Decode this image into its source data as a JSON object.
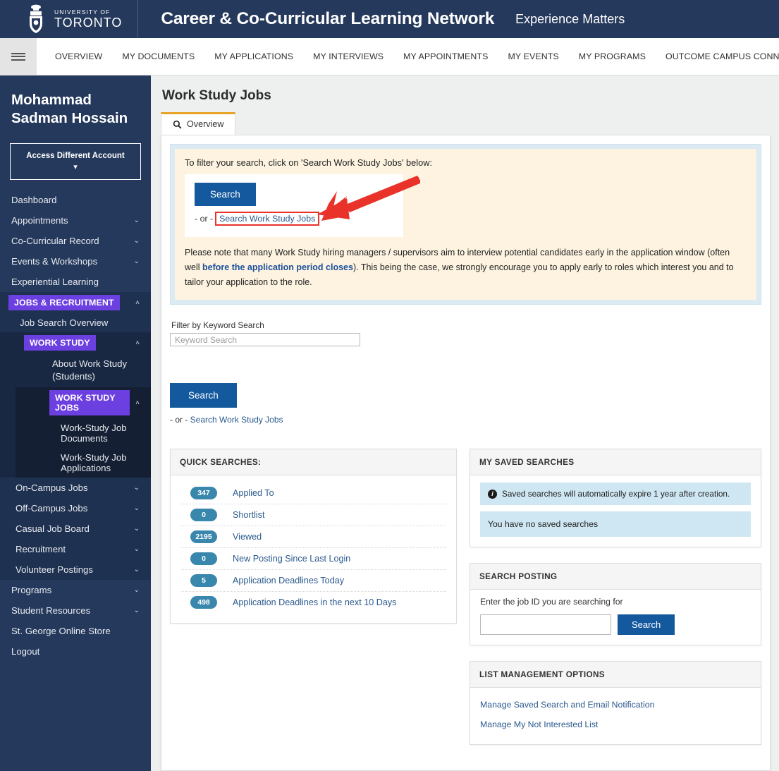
{
  "brand": {
    "logo_line1": "UNIVERSITY OF",
    "logo_line2": "TORONTO",
    "title": "Career & Co-Curricular Learning Network",
    "subtitle": "Experience Matters",
    "navy": "#25395c"
  },
  "topnav": {
    "menu_icon": "hamburger-icon",
    "items": [
      "OVERVIEW",
      "MY DOCUMENTS",
      "MY APPLICATIONS",
      "MY INTERVIEWS",
      "MY APPOINTMENTS",
      "MY EVENTS",
      "MY PROGRAMS",
      "OUTCOME CAMPUS CONNECT"
    ]
  },
  "sidebar": {
    "user_line1": "Mohammad",
    "user_line2": "Sadman Hossain",
    "account_switch": "Access Different Account",
    "accent_purple": "#6b3fe0",
    "items": [
      {
        "label": "Dashboard",
        "chevron": ""
      },
      {
        "label": "Appointments",
        "chevron": "⌄"
      },
      {
        "label": "Co-Curricular Record",
        "chevron": "⌄"
      },
      {
        "label": "Events & Workshops",
        "chevron": "⌄"
      },
      {
        "label": "Experiential Learning",
        "chevron": ""
      }
    ],
    "jobs_section": {
      "label": "JOBS & RECRUITMENT",
      "chevron": "˄",
      "overview": "Job Search Overview",
      "work_study": {
        "label": "WORK STUDY",
        "chevron": "˄",
        "about": "About Work Study (Students)",
        "jobs": {
          "label": "WORK STUDY JOBS",
          "chevron": "˄",
          "children": [
            "Work-Study Job Documents",
            "Work-Study Job Applications"
          ]
        }
      },
      "siblings": [
        {
          "label": "On-Campus Jobs",
          "chevron": "⌄"
        },
        {
          "label": "Off-Campus Jobs",
          "chevron": "⌄"
        },
        {
          "label": "Casual Job Board",
          "chevron": "⌄"
        },
        {
          "label": "Recruitment",
          "chevron": "⌄"
        },
        {
          "label": "Volunteer Postings",
          "chevron": "⌄"
        }
      ]
    },
    "footer_items": [
      {
        "label": "Programs",
        "chevron": "⌄"
      },
      {
        "label": "Student Resources",
        "chevron": "⌄"
      },
      {
        "label": "St. George Online Store",
        "chevron": ""
      },
      {
        "label": "Logout",
        "chevron": ""
      }
    ]
  },
  "page": {
    "title": "Work Study Jobs",
    "tab_label": "Overview",
    "tab_icon": "search-icon"
  },
  "alert": {
    "lead": "To filter your search, click on 'Search Work Study Jobs' below:",
    "search_button": "Search",
    "or_text": "- or -",
    "highlight_link": "Search Work Study Jobs",
    "body_part1": "Please note that many Work Study hiring managers / supervisors aim to interview potential candidates early in the application window (often well ",
    "body_bold": "before the application period closes",
    "body_part2": "). This being the case, we strongly encourage you to apply early to roles which interest you and to tailor your application to the role.",
    "annotation": "red-arrow-pointing-to-search-work-study-jobs-link",
    "annotation_color": "#e8322a"
  },
  "filter": {
    "label": "Filter by Keyword Search",
    "placeholder": "Keyword Search",
    "value": "",
    "search_button": "Search",
    "or_text": "- or - ",
    "or_link": "Search Work Study Jobs"
  },
  "quick_searches": {
    "title": "QUICK SEARCHES:",
    "rows": [
      {
        "count": "347",
        "label": "Applied To"
      },
      {
        "count": "0",
        "label": "Shortlist"
      },
      {
        "count": "2195",
        "label": "Viewed"
      },
      {
        "count": "0",
        "label": "New Posting Since Last Login"
      },
      {
        "count": "5",
        "label": "Application Deadlines Today"
      },
      {
        "count": "498",
        "label": "Application Deadlines in the next 10 Days"
      }
    ],
    "badge_color": "#3a87ad"
  },
  "saved_searches": {
    "title": "MY SAVED SEARCHES",
    "info_icon": "info-icon",
    "info": "Saved searches will automatically expire 1 year after creation.",
    "empty": "You have no saved searches"
  },
  "search_posting": {
    "title": "SEARCH POSTING",
    "label": "Enter the job ID you are searching for",
    "value": "",
    "button": "Search"
  },
  "list_management": {
    "title": "LIST MANAGEMENT OPTIONS",
    "links": [
      "Manage Saved Search and Email Notification",
      "Manage My Not Interested List"
    ]
  }
}
